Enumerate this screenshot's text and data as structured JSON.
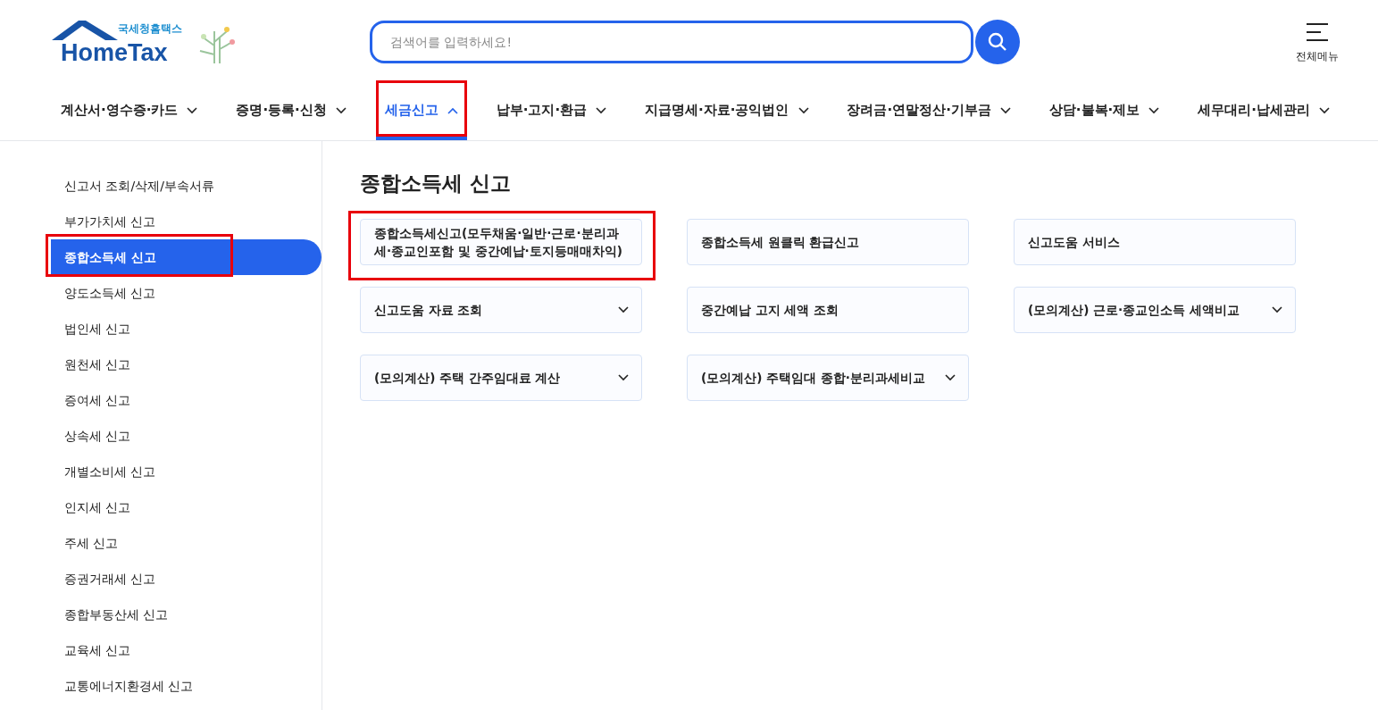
{
  "logo": {
    "subtitle": "국세청홈택스",
    "title": "HomeTax"
  },
  "search": {
    "placeholder": "검색어를 입력하세요!"
  },
  "all_menu": {
    "label": "전체메뉴"
  },
  "nav": [
    {
      "label": "계산서·영수증·카드",
      "selected": false,
      "expanded": false,
      "highlighted": false
    },
    {
      "label": "증명·등록·신청",
      "selected": false,
      "expanded": false,
      "highlighted": false
    },
    {
      "label": "세금신고",
      "selected": true,
      "expanded": true,
      "highlighted": true
    },
    {
      "label": "납부·고지·환급",
      "selected": false,
      "expanded": false,
      "highlighted": false
    },
    {
      "label": "지급명세·자료·공익법인",
      "selected": false,
      "expanded": false,
      "highlighted": false
    },
    {
      "label": "장려금·연말정산·기부금",
      "selected": false,
      "expanded": false,
      "highlighted": false
    },
    {
      "label": "상담·불복·제보",
      "selected": false,
      "expanded": false,
      "highlighted": false
    },
    {
      "label": "세무대리·납세관리",
      "selected": false,
      "expanded": false,
      "highlighted": false
    }
  ],
  "sidebar": {
    "items": [
      {
        "label": "신고서 조회/삭제/부속서류",
        "selected": false,
        "highlighted": false
      },
      {
        "label": "부가가치세 신고",
        "selected": false,
        "highlighted": false
      },
      {
        "label": "종합소득세 신고",
        "selected": true,
        "highlighted": true
      },
      {
        "label": "양도소득세 신고",
        "selected": false,
        "highlighted": false
      },
      {
        "label": "법인세 신고",
        "selected": false,
        "highlighted": false
      },
      {
        "label": "원천세 신고",
        "selected": false,
        "highlighted": false
      },
      {
        "label": "증여세 신고",
        "selected": false,
        "highlighted": false
      },
      {
        "label": "상속세 신고",
        "selected": false,
        "highlighted": false
      },
      {
        "label": "개별소비세 신고",
        "selected": false,
        "highlighted": false
      },
      {
        "label": "인지세 신고",
        "selected": false,
        "highlighted": false
      },
      {
        "label": "주세 신고",
        "selected": false,
        "highlighted": false
      },
      {
        "label": "증권거래세 신고",
        "selected": false,
        "highlighted": false
      },
      {
        "label": "종합부동산세 신고",
        "selected": false,
        "highlighted": false
      },
      {
        "label": "교육세 신고",
        "selected": false,
        "highlighted": false
      },
      {
        "label": "교통에너지환경세 신고",
        "selected": false,
        "highlighted": false
      }
    ]
  },
  "content": {
    "title": "종합소득세 신고",
    "cards": [
      {
        "kind": "link",
        "label": "종합소득세신고(모두채움·일반·근로·분리과세·종교인포함 및 중간예납·토지등매매차익)",
        "highlighted": true
      },
      {
        "kind": "link",
        "label": "종합소득세 원클릭 환급신고",
        "highlighted": false
      },
      {
        "kind": "link",
        "label": "신고도움 서비스",
        "highlighted": false
      },
      {
        "kind": "dropdown",
        "label": "신고도움 자료 조회",
        "highlighted": false
      },
      {
        "kind": "link",
        "label": "중간예납 고지 세액 조회",
        "highlighted": false
      },
      {
        "kind": "dropdown",
        "label": "(모의계산) 근로·종교인소득 세액비교",
        "highlighted": false
      },
      {
        "kind": "dropdown",
        "label": "(모의계산) 주택 간주임대료 계산",
        "highlighted": false
      },
      {
        "kind": "dropdown",
        "label": "(모의계산) 주택임대 종합·분리과세비교",
        "highlighted": false
      }
    ]
  }
}
